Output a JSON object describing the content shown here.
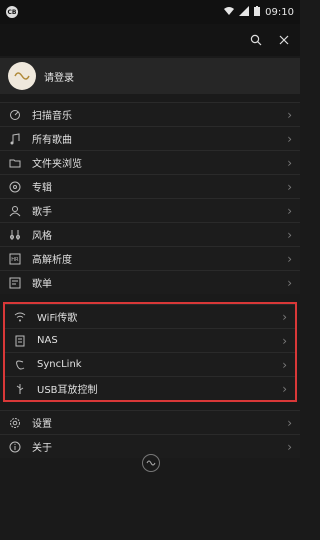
{
  "status_bar": {
    "time": "09:10",
    "badge": "CB"
  },
  "user": {
    "login_label": "请登录"
  },
  "menu_group_1": [
    {
      "icon": "scan-icon",
      "label": "扫描音乐"
    },
    {
      "icon": "music-note-icon",
      "label": "所有歌曲"
    },
    {
      "icon": "folder-icon",
      "label": "文件夹浏览"
    },
    {
      "icon": "album-icon",
      "label": "专辑"
    },
    {
      "icon": "person-icon",
      "label": "歌手"
    },
    {
      "icon": "genre-icon",
      "label": "风格"
    },
    {
      "icon": "hires-icon",
      "label": "高解析度"
    },
    {
      "icon": "playlist-icon",
      "label": "歌单"
    }
  ],
  "menu_group_2": [
    {
      "icon": "wifi-icon",
      "label": "WiFi传歌"
    },
    {
      "icon": "nas-icon",
      "label": "NAS"
    },
    {
      "icon": "synclink-icon",
      "label": "SyncLink"
    },
    {
      "icon": "usb-icon",
      "label": "USB耳放控制"
    }
  ],
  "menu_group_3": [
    {
      "icon": "settings-icon",
      "label": "设置"
    },
    {
      "icon": "info-icon",
      "label": "关于"
    }
  ],
  "colors": {
    "background": "#1a1a1a",
    "highlight": "#d93838"
  }
}
